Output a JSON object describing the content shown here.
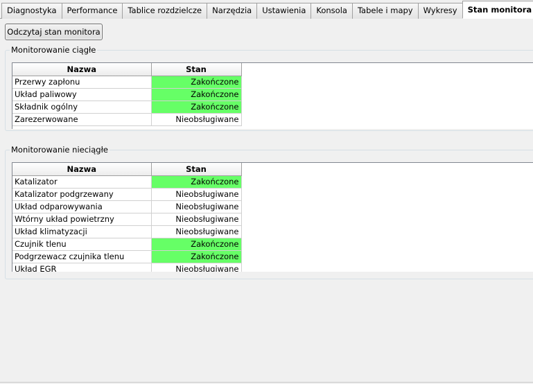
{
  "tabs": [
    {
      "label": "Diagnostyka",
      "active": false
    },
    {
      "label": "Performance",
      "active": false
    },
    {
      "label": "Tablice rozdzielcze",
      "active": false
    },
    {
      "label": "Narzędzia",
      "active": false
    },
    {
      "label": "Ustawienia",
      "active": false
    },
    {
      "label": "Konsola",
      "active": false
    },
    {
      "label": "Tabele i mapy",
      "active": false
    },
    {
      "label": "Wykresy",
      "active": false
    },
    {
      "label": "Stan monitora",
      "active": true
    }
  ],
  "read_button_label": "Odczytaj stan monitora",
  "colors": {
    "done": "#66ff66"
  },
  "continuous": {
    "title": "Monitorowanie ciągłe",
    "columns": {
      "name": "Nazwa",
      "status": "Stan"
    },
    "rows": [
      {
        "name": "Przerwy zapłonu",
        "status": "Zakończone",
        "done": true
      },
      {
        "name": "Układ paliwowy",
        "status": "Zakończone",
        "done": true
      },
      {
        "name": "Składnik ogólny",
        "status": "Zakończone",
        "done": true
      },
      {
        "name": "Zarezerwowane",
        "status": "Nieobsługiwane",
        "done": false
      }
    ]
  },
  "noncontinuous": {
    "title": "Monitorowanie nieciągłe",
    "columns": {
      "name": "Nazwa",
      "status": "Stan"
    },
    "rows": [
      {
        "name": "Katalizator",
        "status": "Zakończone",
        "done": true
      },
      {
        "name": "Katalizator podgrzewany",
        "status": "Nieobsługiwane",
        "done": false
      },
      {
        "name": "Układ odparowywania",
        "status": "Nieobsługiwane",
        "done": false
      },
      {
        "name": "Wtórny układ powietrzny",
        "status": "Nieobsługiwane",
        "done": false
      },
      {
        "name": "Układ klimatyzacji",
        "status": "Nieobsługiwane",
        "done": false
      },
      {
        "name": "Czujnik tlenu",
        "status": "Zakończone",
        "done": true
      },
      {
        "name": "Podgrzewacz czujnika tlenu",
        "status": "Zakończone",
        "done": true
      },
      {
        "name": "Układ EGR",
        "status": "Nieobsługiwane",
        "done": false
      }
    ]
  }
}
